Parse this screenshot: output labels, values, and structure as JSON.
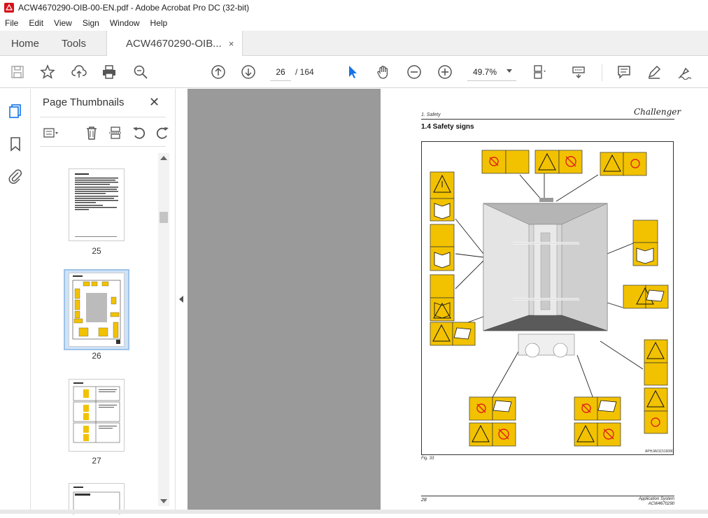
{
  "window": {
    "title": "ACW4670290-OIB-00-EN.pdf - Adobe Acrobat Pro DC (32-bit)"
  },
  "menu": [
    "File",
    "Edit",
    "View",
    "Sign",
    "Window",
    "Help"
  ],
  "tabs": {
    "home": "Home",
    "tools": "Tools",
    "document": "ACW4670290-OIB...",
    "close": "×"
  },
  "toolbar": {
    "page_current": "26",
    "page_total": "/ 164",
    "zoom": "49.7%"
  },
  "panel": {
    "title": "Page Thumbnails",
    "close": "✕",
    "thumbnails": [
      {
        "label": "25"
      },
      {
        "label": "26"
      },
      {
        "label": "27"
      }
    ]
  },
  "document_page": {
    "header_section": "1. Safety",
    "logo_text": "Challenger",
    "heading": "1.4   Safety signs",
    "figure_code": "APHJA011516080",
    "figure_caption": "Fig. 33",
    "footer_page": "28",
    "footer_line1": "Application System",
    "footer_line2": "ACW4670290"
  },
  "colors": {
    "sign_yellow": "#f2c200",
    "doc_bg": "#9a9a9a",
    "selected_thumb": "#cfe3f7",
    "accent_blue": "#1473e6"
  }
}
